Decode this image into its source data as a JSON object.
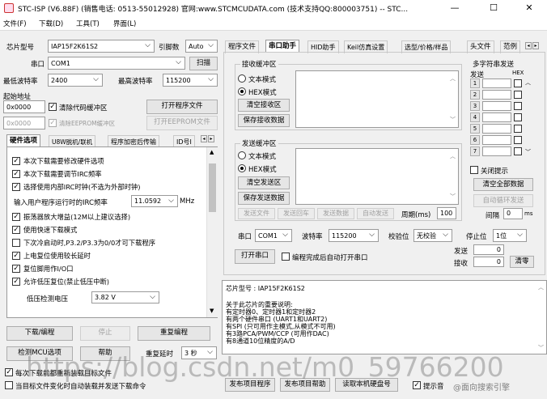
{
  "window": {
    "title": "STC-ISP (V6.88F) (销售电话: 0513-55012928) 官网:www.STCMCUDATA.com  (技术支持QQ:800003751) -- STC...",
    "minimize": "—",
    "maximize": "☐",
    "close": "✕"
  },
  "menu": {
    "file": "文件(F)",
    "download": "下载(D)",
    "tools": "工具(T)",
    "interface": "界面(L)"
  },
  "left": {
    "chip_label": "芯片型号",
    "chip_value": "IAP15F2K61S2",
    "pins_label": "引脚数",
    "pins_value": "Auto",
    "port_label": "串口",
    "port_value": "COM1",
    "scan_btn": "扫描",
    "min_baud_label": "最低波特率",
    "min_baud_value": "2400",
    "max_baud_label": "最高波特率",
    "max_baud_value": "115200",
    "start_addr_label": "起始地址",
    "addr1": "0x0000",
    "clear_code_label": "清除代码缓冲区",
    "open_prog_btn": "打开程序文件",
    "addr2": "0x0000",
    "clear_eep_label": "清除EEPROM缓冲区",
    "open_eep_btn": "打开EEPROM文件",
    "tabs": [
      "硬件选项",
      "U8W脱机/联机",
      "程序加密后传输",
      "ID号I"
    ],
    "options": [
      {
        "label": "本次下载需要修改硬件选项",
        "checked": true
      },
      {
        "label": "本次下载需要调节IRC频率",
        "checked": true
      },
      {
        "label": "选择使用内部IRC时钟(不选为外部时钟)",
        "checked": true
      }
    ],
    "freq_label": "输入用户程序运行时的IRC频率",
    "freq_value": "11.0592",
    "freq_unit": "MHz",
    "options2": [
      {
        "label": "振荡器放大增益(12M以上建议选择)",
        "checked": true
      },
      {
        "label": "使用快速下载模式",
        "checked": true
      },
      {
        "label": "下次冷启动时,P3.2/P3.3为0/0才可下载程序",
        "checked": false
      },
      {
        "label": "上电复位使用较长延时",
        "checked": true
      },
      {
        "label": "复位脚用作I/O口",
        "checked": true
      },
      {
        "label": "允许低压复位(禁止低压中断)",
        "checked": true
      }
    ],
    "lv_label": "低压检测电压",
    "lv_value": "3.82 V",
    "btn_download": "下载/编程",
    "btn_stop": "停止",
    "btn_reprog": "重复编程",
    "btn_detect": "检测MCU选项",
    "btn_help": "帮助",
    "repeat_delay_label": "重复延时",
    "repeat_delay_value": "3 秒",
    "bottom_chk1": "每次下载前都重新装载目标文件",
    "bottom_chk2": "当目标文件变化时自动装载并发送下载命令"
  },
  "right": {
    "tabs": [
      "程序文件",
      "串口助手",
      "HID助手",
      "Keil仿真设置",
      "选型/价格/样品",
      "头文件",
      "范例"
    ],
    "recv_group": "接收缓冲区",
    "send_group": "发送缓冲区",
    "text_mode": "文本模式",
    "hex_mode": "HEX模式",
    "clear_recv": "清空接收区",
    "save_recv": "保存接收数据",
    "clear_send": "清空发送区",
    "save_send": "保存发送数据",
    "send_file": "发送文件",
    "send_return": "发送回车",
    "send_data": "发送数据",
    "auto_send": "自动发送",
    "period_label": "周期(ms)",
    "period_value": "100",
    "multi_title": "多字符串发送",
    "multi_send_col": "发送",
    "multi_hex_col": "HEX",
    "rows": [
      "1",
      "2",
      "3",
      "4",
      "5",
      "6",
      "7"
    ],
    "close_prompt": "关闭提示",
    "clear_all": "清空全部数据",
    "auto_loop": "自动循环发送",
    "interval_label": "间隔",
    "interval_value": "0",
    "interval_unit": "ms",
    "port_label": "串口",
    "port_value": "COM1",
    "baud_label": "波特率",
    "baud_value": "115200",
    "parity_label": "校验位",
    "parity_value": "无校验",
    "stop_label": "停止位",
    "stop_value": "1位",
    "open_port": "打开串口",
    "auto_open": "编程完成后自动打开串口",
    "sent_label": "发送",
    "sent_value": "0",
    "recv_label": "接收",
    "recv_value": "0",
    "clear_btn": "清零"
  },
  "info": {
    "lines": [
      "芯片型号 : IAP15F2K61S2",
      "",
      "关于此芯片的重要说明:",
      "  有定时器0、定时器1和定时器2",
      "  有两个硬件串口 (UART1和UART2)",
      "  有SPI (只可用作主模式,从模式不可用)",
      "  有3路PCA/PWM/CCP (可用作DAC)",
      "  有8通道10位精度的A/D"
    ]
  },
  "bottom_right": {
    "btn1": "发布项目程序",
    "btn2": "发布项目帮助",
    "btn3": "读取本机硬盘号",
    "chk": "提示音"
  },
  "watermark": "https://blog.csdn.net/m0_59766200",
  "watermark2": "@面向搜索引擎"
}
